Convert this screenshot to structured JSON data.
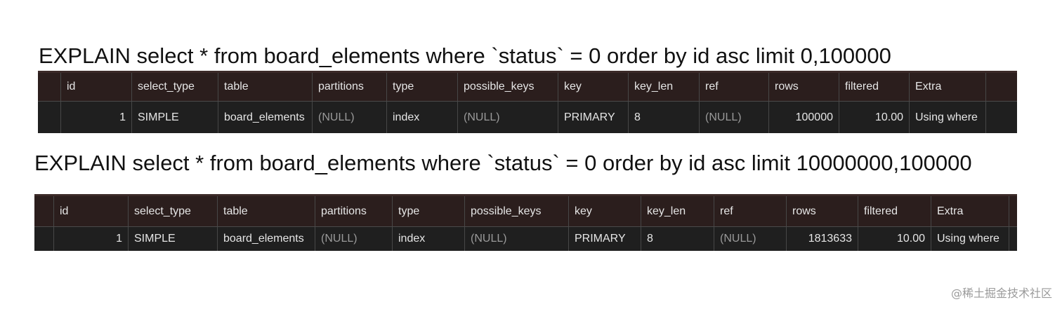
{
  "queries": [
    {
      "sql": "EXPLAIN select * from board_elements where `status` = 0 order by id asc limit 0,100000",
      "columns": [
        "id",
        "select_type",
        "table",
        "partitions",
        "type",
        "possible_keys",
        "key",
        "key_len",
        "ref",
        "rows",
        "filtered",
        "Extra"
      ],
      "row": [
        "1",
        "SIMPLE",
        "board_elements",
        "(NULL)",
        "index",
        "(NULL)",
        "PRIMARY",
        "8",
        "(NULL)",
        "100000",
        "10.00",
        "Using where"
      ]
    },
    {
      "sql": "EXPLAIN select * from board_elements where `status` = 0 order by id asc limit 10000000,100000",
      "columns": [
        "id",
        "select_type",
        "table",
        "partitions",
        "type",
        "possible_keys",
        "key",
        "key_len",
        "ref",
        "rows",
        "filtered",
        "Extra"
      ],
      "row": [
        "1",
        "SIMPLE",
        "board_elements",
        "(NULL)",
        "index",
        "(NULL)",
        "PRIMARY",
        "8",
        "(NULL)",
        "1813633",
        "10.00",
        "Using where"
      ]
    }
  ],
  "watermark": "@稀土掘金技术社区",
  "colors": {
    "header_bg": "#2b1e1d",
    "row_bg": "#1f1f1f",
    "text": "#e6e6e6",
    "null_text": "#9a9a9a",
    "grid": "#474747"
  }
}
